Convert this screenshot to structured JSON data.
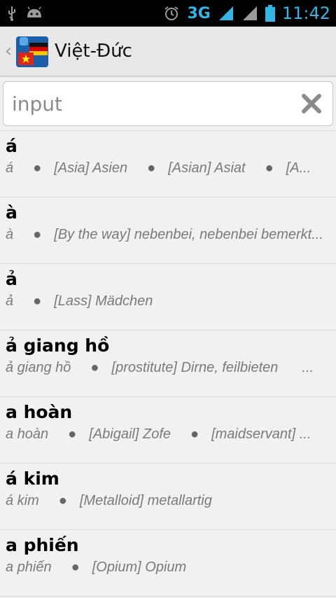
{
  "status": {
    "network": "3G",
    "time": "11:42"
  },
  "appbar": {
    "title": "Việt-Đức"
  },
  "search": {
    "placeholder": "input",
    "value": ""
  },
  "entries": [
    {
      "head": "á",
      "sub": "á",
      "defs": [
        "[Asia] Asien",
        "[Asian] Asiat",
        "[A..."
      ]
    },
    {
      "head": "à",
      "sub": "à",
      "defs": [
        "[By the way] nebenbei, nebenbei bemerkt..."
      ]
    },
    {
      "head": "ả",
      "sub": "ả",
      "defs": [
        "[Lass] Mädchen"
      ]
    },
    {
      "head": "ả giang hồ",
      "sub": "ả giang hồ",
      "defs": [
        "[prostitute] Dirne, feilbieten",
        "..."
      ]
    },
    {
      "head": "a hoàn",
      "sub": "a hoàn",
      "defs": [
        "[Abigail] Zofe",
        "[maidservant] ..."
      ]
    },
    {
      "head": "á kim",
      "sub": "á kim",
      "defs": [
        "[Metalloid] metallartig"
      ]
    },
    {
      "head": "a phiến",
      "sub": "a phiến",
      "defs": [
        "[Opium] Opium"
      ]
    }
  ]
}
